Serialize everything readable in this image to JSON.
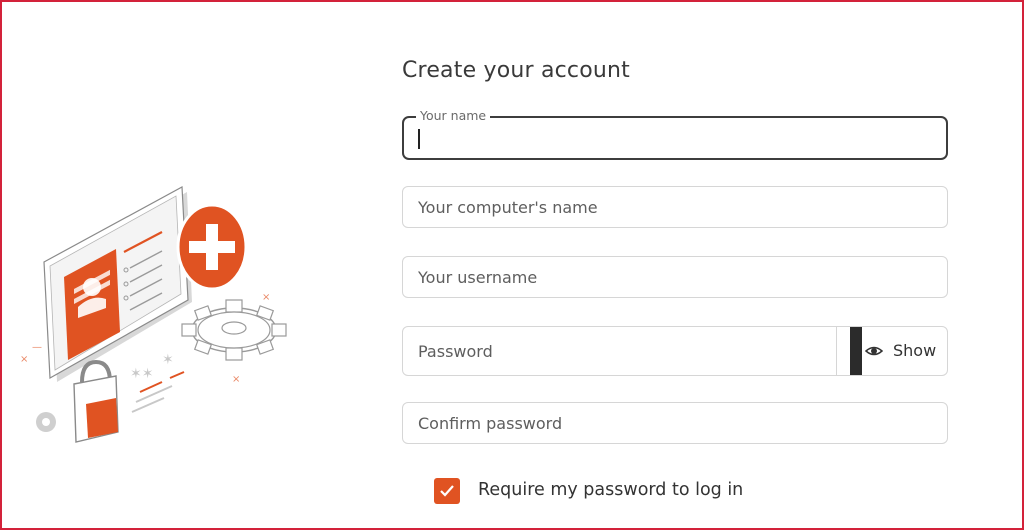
{
  "form": {
    "title": "Create your account",
    "fields": [
      {
        "label": "Your name",
        "value": ""
      },
      {
        "placeholder": "Your computer's name"
      },
      {
        "placeholder": "Your username"
      },
      {
        "placeholder": "Password",
        "toggle_label": "Show"
      },
      {
        "placeholder": "Confirm password"
      }
    ],
    "require_password": {
      "label": "Require my password to log in",
      "checked": true
    }
  },
  "icons": {
    "illustration": "account-creation-illustration",
    "eye": "eye-icon",
    "check": "check-icon"
  },
  "colors": {
    "accent": "#e05322",
    "frame": "#d3223a",
    "focus_border": "#3d3d3d"
  }
}
